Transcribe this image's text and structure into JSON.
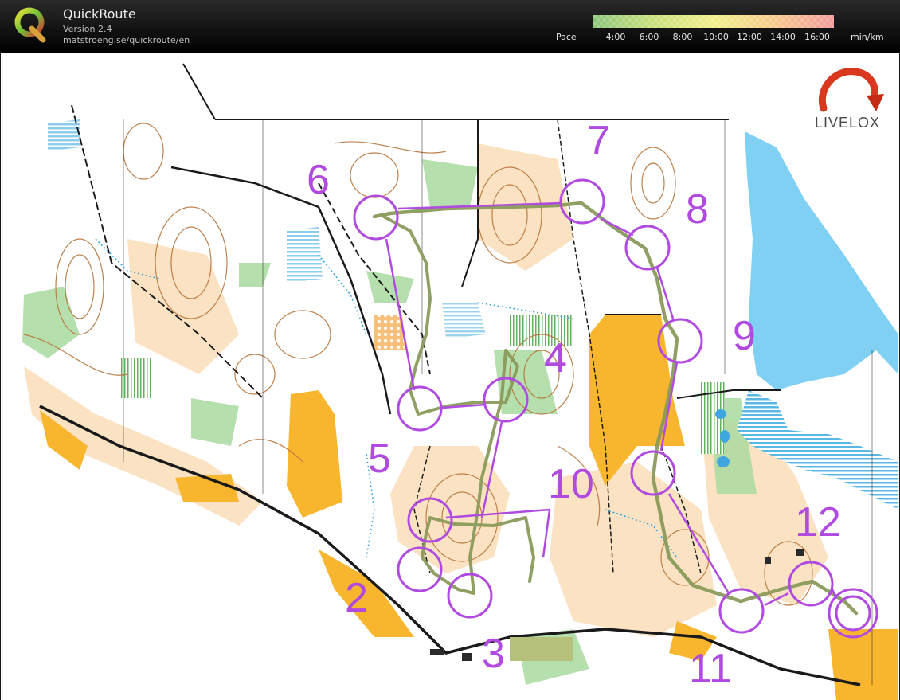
{
  "app": {
    "name": "QuickRoute",
    "version": "Version 2.4",
    "url": "matstroeng.se/quickroute/en"
  },
  "pace_scale": {
    "label": "Pace",
    "unit": "min/km",
    "ticks": [
      "4:00",
      "6:00",
      "8:00",
      "10:00",
      "12:00",
      "14:00",
      "16:00"
    ],
    "colors": [
      "#8bc67a",
      "#c8e07a",
      "#f1ef8a",
      "#f6c98a",
      "#f19a9a"
    ]
  },
  "watermark": {
    "text": "LIVELOX"
  },
  "course": {
    "color": "#b04ae0",
    "controls": [
      {
        "label": "2"
      },
      {
        "label": "3"
      },
      {
        "label": "4"
      },
      {
        "label": "5"
      },
      {
        "label": "6"
      },
      {
        "label": "7"
      },
      {
        "label": "8"
      },
      {
        "label": "9"
      },
      {
        "label": "10"
      },
      {
        "label": "11"
      },
      {
        "label": "12"
      }
    ]
  },
  "map_colors": {
    "water": "#7fd0f2",
    "open_land": "#f8c07a",
    "rough_open": "#fbe2c2",
    "green": "#a9d9a0",
    "contour": "#b8743a",
    "route": "#8a9a5b"
  }
}
